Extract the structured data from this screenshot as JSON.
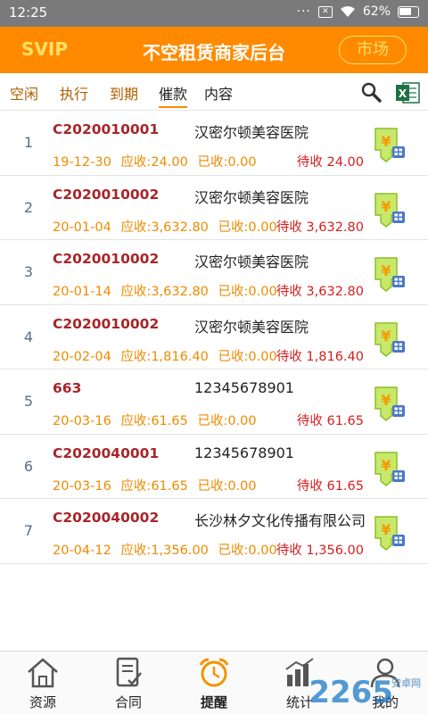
{
  "status_bar": {
    "time": "12:25",
    "dots": "···",
    "battery_pct": "62%"
  },
  "header": {
    "badge": "SVIP",
    "title": "不空租赁商家后台",
    "market_button": "市场"
  },
  "tabs": [
    {
      "label": "空闲",
      "active": false
    },
    {
      "label": "执行",
      "active": false
    },
    {
      "label": "到期",
      "active": false
    },
    {
      "label": "催款",
      "active": true
    },
    {
      "label": "内容",
      "active": false
    }
  ],
  "icons": {
    "search": "search-icon",
    "excel": "excel-icon",
    "pay": "yuan-payment-icon"
  },
  "rows": [
    {
      "index": "1",
      "code": "C2020010001",
      "name": "汉密尔顿美容医院",
      "date": "19-12-30",
      "due": "应收:24.00",
      "paid": "已收:0.00",
      "pending": "待收 24.00"
    },
    {
      "index": "2",
      "code": "C2020010002",
      "name": "汉密尔顿美容医院",
      "date": "20-01-04",
      "due": "应收:3,632.80",
      "paid": "已收:0.00",
      "pending": "待收 3,632.80"
    },
    {
      "index": "3",
      "code": "C2020010002",
      "name": "汉密尔顿美容医院",
      "date": "20-01-14",
      "due": "应收:3,632.80",
      "paid": "已收:0.00",
      "pending": "待收 3,632.80"
    },
    {
      "index": "4",
      "code": "C2020010002",
      "name": "汉密尔顿美容医院",
      "date": "20-02-04",
      "due": "应收:1,816.40",
      "paid": "已收:0.00",
      "pending": "待收 1,816.40"
    },
    {
      "index": "5",
      "code": "663",
      "name": "12345678901",
      "date": "20-03-16",
      "due": "应收:61.65",
      "paid": "已收:0.00",
      "pending": "待收 61.65"
    },
    {
      "index": "6",
      "code": "C2020040001",
      "name": "12345678901",
      "date": "20-03-16",
      "due": "应收:61.65",
      "paid": "已收:0.00",
      "pending": "待收 61.65"
    },
    {
      "index": "7",
      "code": "C2020040002",
      "name": "长沙林夕文化传播有限公司",
      "date": "20-04-12",
      "due": "应收:1,356.00",
      "paid": "已收:0.00",
      "pending": "待收 1,356.00"
    }
  ],
  "bottom_nav": [
    {
      "label": "资源",
      "icon": "house-icon",
      "active": false
    },
    {
      "label": "合同",
      "icon": "document-icon",
      "active": false
    },
    {
      "label": "提醒",
      "icon": "alarm-clock-icon",
      "active": true
    },
    {
      "label": "统计",
      "icon": "bar-chart-icon",
      "active": false
    },
    {
      "label": "我的",
      "icon": "user-icon",
      "active": false
    }
  ],
  "watermark": {
    "text": "2265",
    "sub": "安卓网"
  },
  "colors": {
    "accent": "#ff8a00",
    "code_red": "#a8252a",
    "amount_orange": "#ee8a00",
    "pending_red": "#d41f1f",
    "status_bar": "#7a7a7a"
  }
}
